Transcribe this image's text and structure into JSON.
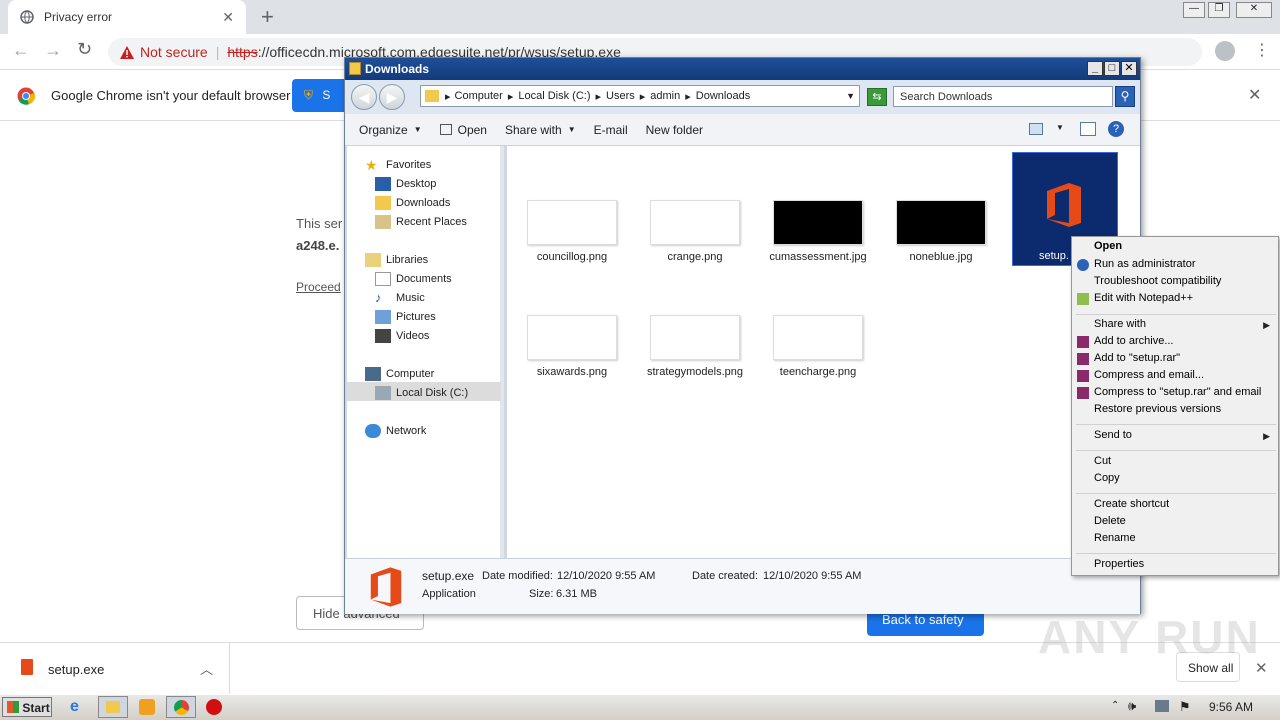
{
  "browser": {
    "tab_title": "Privacy error",
    "new_tab": "+",
    "not_secure": "Not secure",
    "url_scheme": "https",
    "url_rest": "://officecdn.microsoft.com.edgesuite.net/pr/wsus/setup.exe",
    "window_controls": [
      "—",
      "❐",
      "✕"
    ]
  },
  "infobar": {
    "message": "Google Chrome isn't your default browser",
    "button_label": "S"
  },
  "page": {
    "line1": "This ser",
    "line2": "a248.e.",
    "proceed_link": "Proceed",
    "hide_advanced": "Hide advanced",
    "back_to_safety": "Back to safety"
  },
  "downloads_bar": {
    "file_name": "setup.exe",
    "show_all": "Show all"
  },
  "explorer": {
    "title": "Downloads",
    "breadcrumb": [
      "Computer",
      "Local Disk (C:)",
      "Users",
      "admin",
      "Downloads"
    ],
    "search_placeholder": "Search Downloads",
    "commands": {
      "organize": "Organize",
      "open": "Open",
      "share_with": "Share with",
      "email": "E-mail",
      "new_folder": "New folder"
    },
    "nav": {
      "favorites": "Favorites",
      "desktop": "Desktop",
      "downloads": "Downloads",
      "recent": "Recent Places",
      "libraries": "Libraries",
      "documents": "Documents",
      "music": "Music",
      "pictures": "Pictures",
      "videos": "Videos",
      "computer": "Computer",
      "local_disk": "Local Disk (C:)",
      "network": "Network"
    },
    "files": [
      {
        "name": "councillog.png"
      },
      {
        "name": "crange.png"
      },
      {
        "name": "cumassessment.jpg"
      },
      {
        "name": "noneblue.jpg"
      },
      {
        "name": "setup.exe"
      },
      {
        "name": "sixawards.png"
      },
      {
        "name": "strategymodels.png"
      },
      {
        "name": "teencharge.png"
      }
    ],
    "setup_label": "setup.",
    "details": {
      "name": "setup.exe",
      "modified_label": "Date modified:",
      "modified": "12/10/2020 9:55 AM",
      "created_label": "Date created:",
      "created": "12/10/2020 9:55 AM",
      "type": "Application",
      "size_label": "Size:",
      "size": "6.31 MB"
    }
  },
  "context_menu": {
    "open": "Open",
    "run_as_admin": "Run as administrator",
    "troubleshoot": "Troubleshoot compatibility",
    "edit_notepad": "Edit with Notepad++",
    "share_with": "Share with",
    "add_archive": "Add to archive...",
    "add_rar": "Add to \"setup.rar\"",
    "compress_email": "Compress and email...",
    "compress_rar_email": "Compress to \"setup.rar\" and email",
    "restore": "Restore previous versions",
    "send_to": "Send to",
    "cut": "Cut",
    "copy": "Copy",
    "create_shortcut": "Create shortcut",
    "delete": "Delete",
    "rename": "Rename",
    "properties": "Properties"
  },
  "taskbar": {
    "start": "Start",
    "clock": "9:56 AM"
  },
  "watermark": "ANY RUN",
  "colors": {
    "accent_blue": "#1a73e8",
    "not_secure_red": "#c5221f",
    "office_orange": "#e64a19",
    "selection_navy": "#0c2a6e"
  }
}
